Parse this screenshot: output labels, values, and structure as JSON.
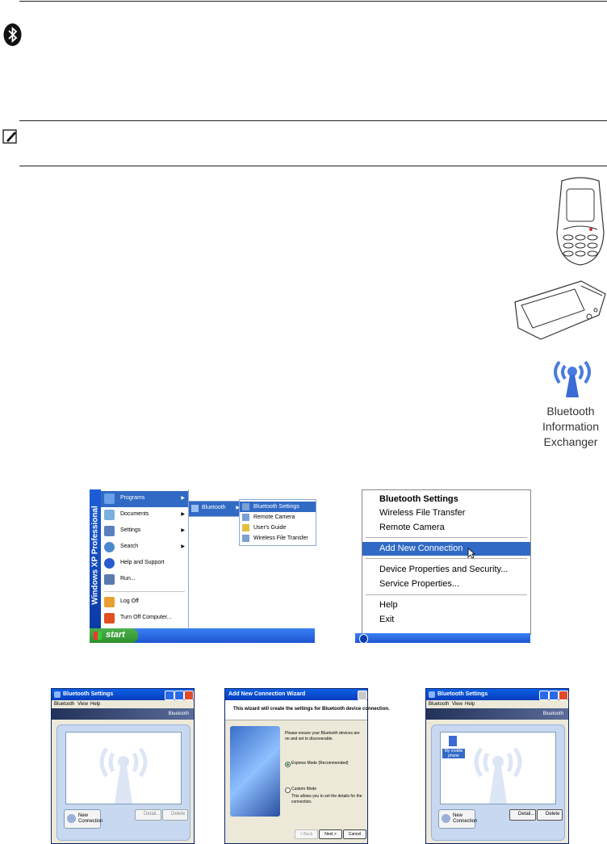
{
  "start_menu": {
    "sidebar_text": "Windows XP Professional",
    "items": [
      "Programs",
      "Documents",
      "Settings",
      "Search",
      "Help and Support",
      "Run...",
      "Log Off",
      "Turn Off Computer..."
    ],
    "submenu": "Bluetooth",
    "submenu2": [
      "Bluetooth Settings",
      "Remote Camera",
      "User's Guide",
      "Wireless File Transfer"
    ],
    "start_label": "start"
  },
  "context_menu": {
    "items": [
      "Bluetooth Settings",
      "Wireless File Transfer",
      "Remote Camera",
      "Add New Connection",
      "Device Properties and Security...",
      "Service Properties...",
      "Help",
      "Exit"
    ]
  },
  "icon_label": {
    "line1": "Bluetooth",
    "line2": "Information",
    "line3": "Exchanger"
  },
  "win1": {
    "title": "Bluetooth Settings",
    "menu": [
      "Bluetooth",
      "View",
      "Help"
    ],
    "band": "Bluetooth",
    "nc": [
      "New",
      "Connection"
    ],
    "detail": "Detail...",
    "delete": "Delete"
  },
  "wizard": {
    "title": "Add New Connection Wizard",
    "header": "This wizard will create the settings for Bluetooth device connection.",
    "intro": "Please ensure your Bluetooth devices are on and set to discoverable.",
    "express": "Express Mode (Recommended)",
    "custom": "Custom Mode",
    "custom_desc": "This allows you to set the details for the connection.",
    "back": "< Back",
    "next": "Next >",
    "cancel": "Cancel"
  },
  "win3": {
    "title": "Bluetooth Settings",
    "menu": [
      "Bluetooth",
      "View",
      "Help"
    ],
    "band": "Bluetooth",
    "device_line1": "My mobile",
    "device_line2": "phone",
    "nc": [
      "New",
      "Connection"
    ],
    "detail": "Detail...",
    "delete": "Delete"
  }
}
